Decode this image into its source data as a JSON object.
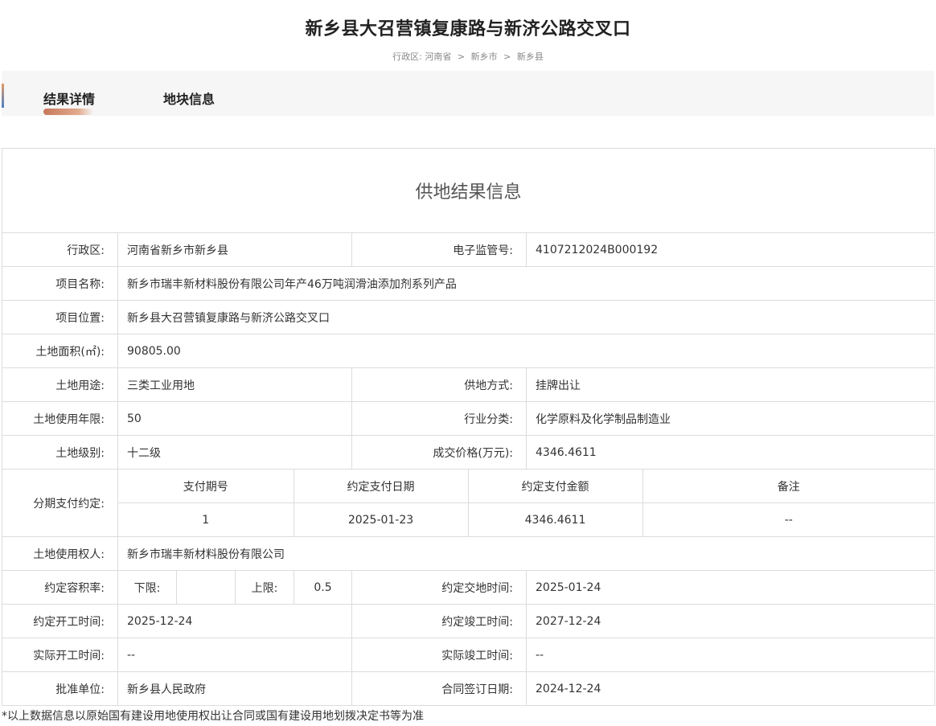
{
  "page": {
    "title": "新乡县大召营镇复康路与新济公路交叉口",
    "breadcrumb": {
      "prefix": "行政区:",
      "province": "河南省",
      "city": "新乡市",
      "county": "新乡县",
      "sep": ">"
    }
  },
  "tabs": [
    {
      "label": "结果详情",
      "active": true
    },
    {
      "label": "地块信息",
      "active": false
    }
  ],
  "result": {
    "heading": "供地结果信息",
    "rows": {
      "district": {
        "label": "行政区:",
        "value": "河南省新乡市新乡县"
      },
      "supervision_no": {
        "label": "电子监管号:",
        "value": "4107212024B000192"
      },
      "project_name": {
        "label": "项目名称:",
        "value": "新乡市瑞丰新材料股份有限公司年产46万吨润滑油添加剂系列产品"
      },
      "project_location": {
        "label": "项目位置:",
        "value": "新乡县大召营镇复康路与新济公路交叉口"
      },
      "land_area": {
        "label": "土地面积(㎡):",
        "value": "90805.00"
      },
      "land_use": {
        "label": "土地用途:",
        "value": "三类工业用地"
      },
      "supply_method": {
        "label": "供地方式:",
        "value": "挂牌出让"
      },
      "use_term": {
        "label": "土地使用年限:",
        "value": "50"
      },
      "industry": {
        "label": "行业分类:",
        "value": "化学原料及化学制品制造业"
      },
      "land_grade": {
        "label": "土地级别:",
        "value": "十二级"
      },
      "price": {
        "label": "成交价格(万元):",
        "value": "4346.4611"
      },
      "installment": {
        "label": "分期支付约定:",
        "headers": [
          "支付期号",
          "约定支付日期",
          "约定支付金额",
          "备注"
        ],
        "rows": [
          [
            "1",
            "2025-01-23",
            "4346.4611",
            "--"
          ]
        ]
      },
      "land_user": {
        "label": "土地使用权人:",
        "value": "新乡市瑞丰新材料股份有限公司"
      },
      "far": {
        "label": "约定容积率:",
        "lower_label": "下限:",
        "lower_value": "",
        "upper_label": "上限:",
        "upper_value": "0.5"
      },
      "handover_time": {
        "label": "约定交地时间:",
        "value": "2025-01-24"
      },
      "start_time": {
        "label": "约定开工时间:",
        "value": "2025-12-24"
      },
      "finish_time": {
        "label": "约定竣工时间:",
        "value": "2027-12-24"
      },
      "actual_start": {
        "label": "实际开工时间:",
        "value": "--"
      },
      "actual_finish": {
        "label": "实际竣工时间:",
        "value": "--"
      },
      "approver": {
        "label": "批准单位:",
        "value": "新乡县人民政府"
      },
      "contract_date": {
        "label": "合同签订日期:",
        "value": "2024-12-24"
      }
    }
  },
  "footnote": "*以上数据信息以原始国有建设用地使用权出让合同或国有建设用地划拨决定书等为准"
}
